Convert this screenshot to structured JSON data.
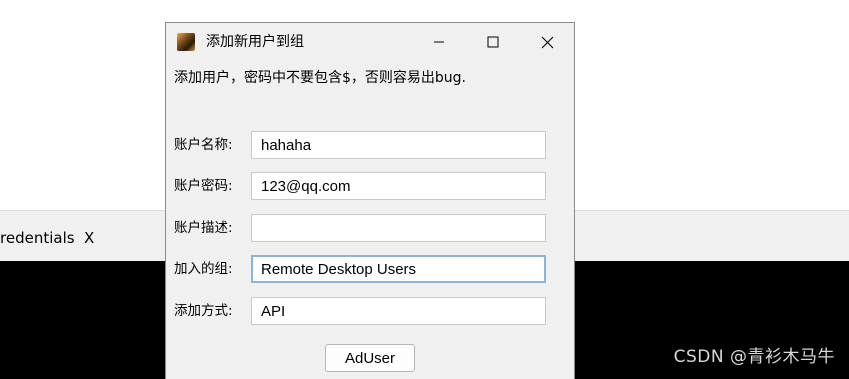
{
  "background": {
    "tab_label": "redentials",
    "tab_close": "X",
    "watermark": "CSDN @青衫木马牛"
  },
  "dialog": {
    "title": "添加新用户到组",
    "icon": "app-avatar-icon",
    "controls": {
      "minimize": "minimize-icon",
      "maximize": "maximize-icon",
      "close": "close-icon"
    },
    "hint": "添加用户，密码中不要包含$，否则容易出bug.",
    "fields": [
      {
        "label": "账户名称:",
        "value": "hahaha"
      },
      {
        "label": "账户密码:",
        "value": "123@qq.com"
      },
      {
        "label": "账户描述:",
        "value": ""
      },
      {
        "label": "加入的组:",
        "value": "Remote Desktop Users"
      },
      {
        "label": "添加方式:",
        "value": "API"
      }
    ],
    "submit_label": "AdUser"
  }
}
